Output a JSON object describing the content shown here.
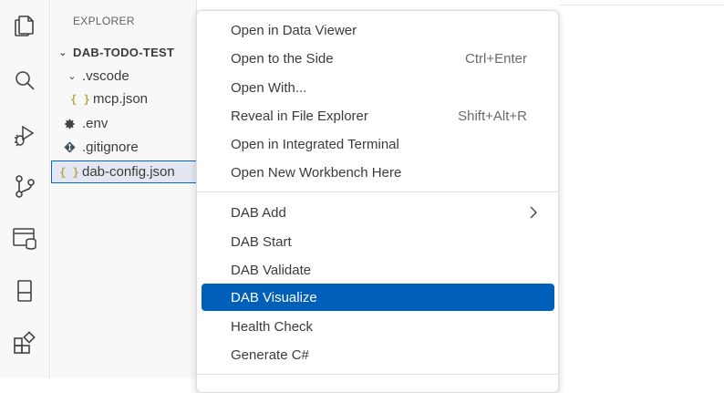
{
  "sidebar": {
    "title": "EXPLORER",
    "tree": [
      {
        "label": "DAB-TODO-TEST",
        "type": "root",
        "expanded": true
      },
      {
        "label": ".vscode",
        "type": "folder",
        "expanded": true
      },
      {
        "label": "mcp.json",
        "type": "json",
        "icon": "{ }"
      },
      {
        "label": ".env",
        "type": "settings"
      },
      {
        "label": ".gitignore",
        "type": "git"
      },
      {
        "label": "dab-config.json",
        "type": "json",
        "icon": "{ }",
        "selected": true
      }
    ]
  },
  "context_menu": {
    "group1": [
      {
        "label": "Open in Data Viewer",
        "shortcut": ""
      },
      {
        "label": "Open to the Side",
        "shortcut": "Ctrl+Enter"
      },
      {
        "label": "Open With...",
        "shortcut": ""
      },
      {
        "label": "Reveal in File Explorer",
        "shortcut": "Shift+Alt+R"
      },
      {
        "label": "Open in Integrated Terminal",
        "shortcut": ""
      },
      {
        "label": "Open New Workbench Here",
        "shortcut": ""
      }
    ],
    "group2": [
      {
        "label": "DAB Add",
        "has_submenu": true
      },
      {
        "label": "DAB Start"
      },
      {
        "label": "DAB Validate"
      },
      {
        "label": "DAB Visualize",
        "active": true
      },
      {
        "label": "Health Check"
      },
      {
        "label": "Generate C#"
      }
    ]
  },
  "colors": {
    "accent": "#005fb8",
    "selection_outline": "#0069d1",
    "json_icon": "#b8a84a"
  }
}
